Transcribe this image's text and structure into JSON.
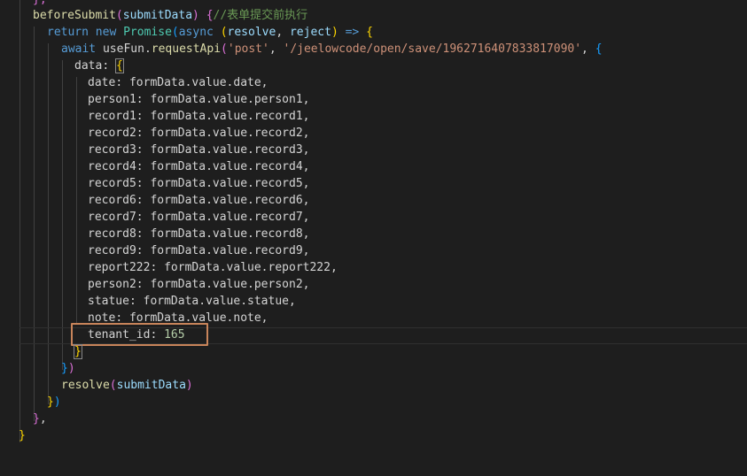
{
  "code": {
    "top_partial": "},",
    "before_submit": "beforeSubmit",
    "submit_data": "submitData",
    "comment": "//表单提交前执行",
    "kw_return": "return",
    "kw_new": "new",
    "promise": "Promise",
    "kw_async": "async",
    "resolve": "resolve",
    "reject": "reject",
    "arrow": "=>",
    "kw_await": "await",
    "use_fun": "useFun",
    "request_api": "requestApi",
    "method": "'post'",
    "url": "'/jeelowcode/open/save/1962716407833817090'",
    "data_key": "data",
    "fields": [
      {
        "key": "date",
        "value": "formData.value.date,"
      },
      {
        "key": "person1",
        "value": "formData.value.person1,"
      },
      {
        "key": "record1",
        "value": "formData.value.record1,"
      },
      {
        "key": "record2",
        "value": "formData.value.record2,"
      },
      {
        "key": "record3",
        "value": "formData.value.record3,"
      },
      {
        "key": "record4",
        "value": "formData.value.record4,"
      },
      {
        "key": "record5",
        "value": "formData.value.record5,"
      },
      {
        "key": "record6",
        "value": "formData.value.record6,"
      },
      {
        "key": "record7",
        "value": "formData.value.record7,"
      },
      {
        "key": "record8",
        "value": "formData.value.record8,"
      },
      {
        "key": "record9",
        "value": "formData.value.record9,"
      },
      {
        "key": "report222",
        "value": "formData.value.report222,"
      },
      {
        "key": "person2",
        "value": "formData.value.person2,"
      },
      {
        "key": "statue",
        "value": "formData.value.statue,"
      },
      {
        "key": "note",
        "value": "formData.value.note,"
      }
    ],
    "tenant_key": "tenant_id",
    "tenant_value": "165",
    "resolve_call": "resolve",
    "resolve_arg": "submitData"
  }
}
